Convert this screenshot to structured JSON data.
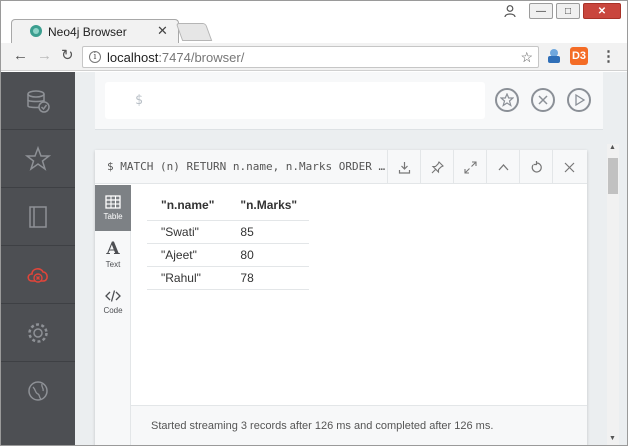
{
  "browser": {
    "tab_title": "Neo4j Browser",
    "tab_close": "✕",
    "url_host": "localhost",
    "url_path": ":7474/browser/",
    "window_controls": {
      "minimize": "—",
      "maximize": "□",
      "close": "✕"
    }
  },
  "editor": {
    "prompt": "$"
  },
  "frame": {
    "query": "$ MATCH (n) RETURN n.name, n.Marks ORDER …"
  },
  "views": [
    {
      "label": "Table"
    },
    {
      "label": "Text"
    },
    {
      "label": "Code"
    }
  ],
  "table": {
    "headers": [
      "\"n.name\"",
      "\"n.Marks\""
    ],
    "rows": [
      [
        "\"Swati\"",
        "85"
      ],
      [
        "\"Ajeet\"",
        "80"
      ],
      [
        "\"Rahul\"",
        "78"
      ]
    ]
  },
  "status": {
    "message": "Started streaming 3 records after 126 ms and completed after 126 ms."
  },
  "colors": {
    "sidebar_bg": "#4d4f53",
    "sidebar_alert": "#e0453a",
    "active_view_bg": "#7d8185",
    "app_bg": "#ebeef0"
  },
  "icons": {
    "sidebar": [
      "database-icon",
      "favorites-star-icon",
      "documents-book-icon",
      "cloud-disconnected-icon",
      "settings-gear-icon",
      "about-icon"
    ],
    "frame_actions": [
      "download-icon",
      "pin-icon",
      "fullscreen-icon",
      "collapse-icon",
      "rerun-icon",
      "close-icon"
    ]
  }
}
